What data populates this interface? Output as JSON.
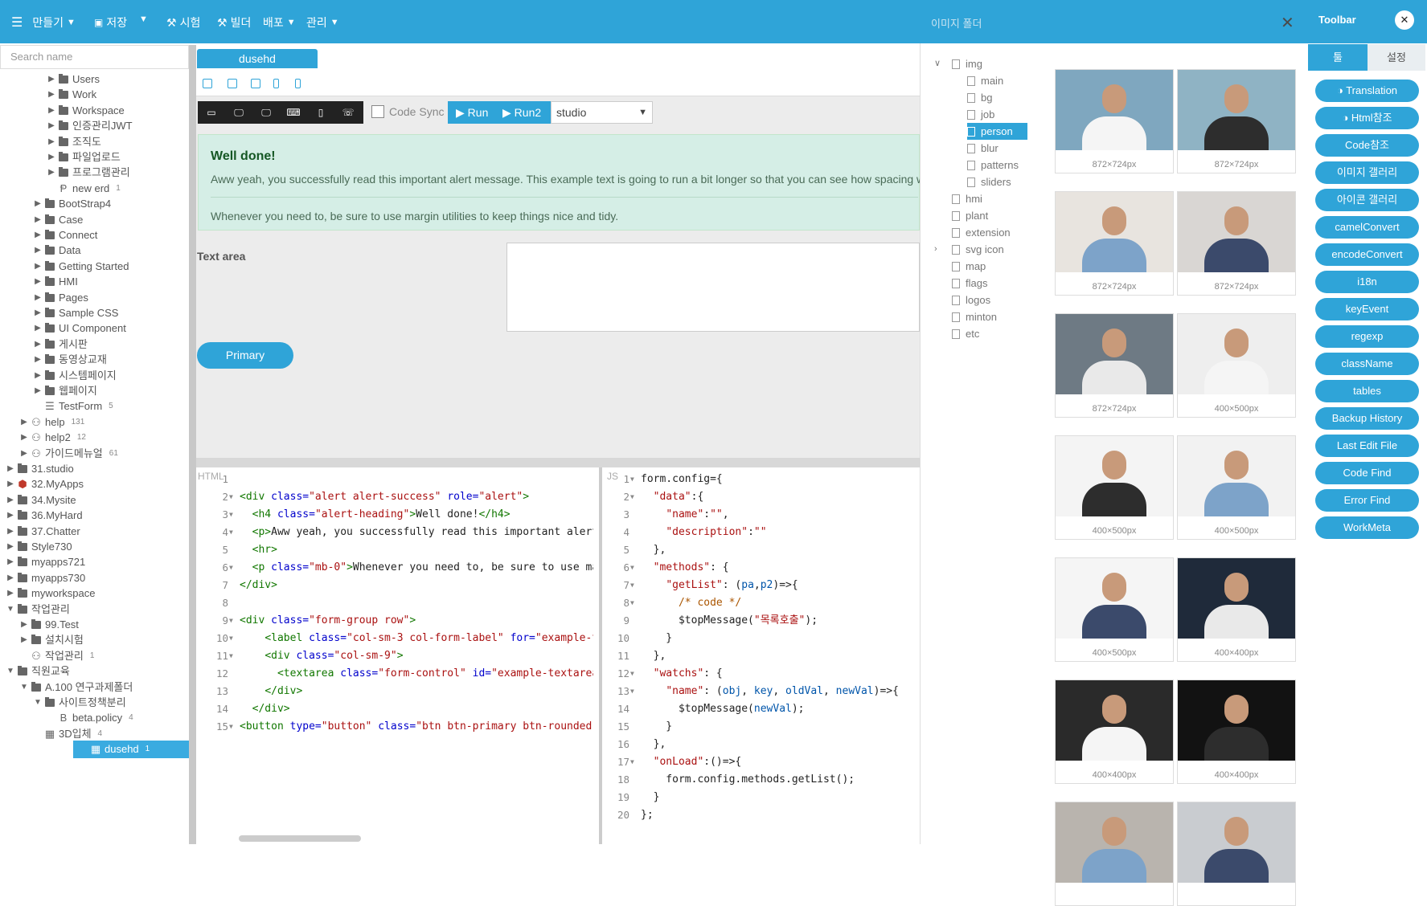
{
  "topbar": {
    "menu": [
      {
        "label": "만들기",
        "icon": "menu-icon",
        "chevron": true
      },
      {
        "label": "저장",
        "icon": "save-icon",
        "chevron": false
      },
      {
        "label": "",
        "icon": "",
        "chevron": true
      },
      {
        "label": "시험",
        "icon": "hammer-icon",
        "chevron": false
      },
      {
        "label": "빌더",
        "icon": "hammer-icon",
        "chevron": false
      },
      {
        "label": "배포",
        "icon": "",
        "chevron": true
      },
      {
        "label": "관리",
        "icon": "",
        "chevron": true
      }
    ]
  },
  "sidebar": {
    "search_placeholder": "Search name",
    "tree": [
      {
        "label": "Users",
        "indent": 3,
        "type": "folder",
        "arrow": "right"
      },
      {
        "label": "Work",
        "indent": 3,
        "type": "folder",
        "arrow": "right"
      },
      {
        "label": "Workspace",
        "indent": 3,
        "type": "folder",
        "arrow": "right"
      },
      {
        "label": "인증관리JWT",
        "indent": 3,
        "type": "folder",
        "arrow": "right"
      },
      {
        "label": "조직도",
        "indent": 3,
        "type": "folder",
        "arrow": "right"
      },
      {
        "label": "파일업로드",
        "indent": 3,
        "type": "folder",
        "arrow": "right"
      },
      {
        "label": "프로그램관리",
        "indent": 3,
        "type": "folder",
        "arrow": "right"
      },
      {
        "label": "new erd",
        "indent": 3,
        "type": "erd",
        "count": "1"
      },
      {
        "label": "BootStrap4",
        "indent": 2,
        "type": "folder",
        "arrow": "right"
      },
      {
        "label": "Case",
        "indent": 2,
        "type": "folder",
        "arrow": "right"
      },
      {
        "label": "Connect",
        "indent": 2,
        "type": "folder",
        "arrow": "right"
      },
      {
        "label": "Data",
        "indent": 2,
        "type": "folder",
        "arrow": "right"
      },
      {
        "label": "Getting Started",
        "indent": 2,
        "type": "folder",
        "arrow": "right"
      },
      {
        "label": "HMI",
        "indent": 2,
        "type": "folder",
        "arrow": "right"
      },
      {
        "label": "Pages",
        "indent": 2,
        "type": "folder",
        "arrow": "right"
      },
      {
        "label": "Sample CSS",
        "indent": 2,
        "type": "folder",
        "arrow": "right"
      },
      {
        "label": "UI Component",
        "indent": 2,
        "type": "folder",
        "arrow": "right"
      },
      {
        "label": "게시판",
        "indent": 2,
        "type": "folder",
        "arrow": "right"
      },
      {
        "label": "동영상교재",
        "indent": 2,
        "type": "folder",
        "arrow": "right"
      },
      {
        "label": "시스템페이지",
        "indent": 2,
        "type": "folder",
        "arrow": "right"
      },
      {
        "label": "웹페이지",
        "indent": 2,
        "type": "folder",
        "arrow": "right"
      },
      {
        "label": "TestForm",
        "indent": 2,
        "type": "form",
        "count": "5"
      },
      {
        "label": "help",
        "indent": 1,
        "type": "group",
        "arrow": "right",
        "count": "131"
      },
      {
        "label": "help2",
        "indent": 1,
        "type": "group",
        "arrow": "right",
        "count": "12"
      },
      {
        "label": "가이드메뉴얼",
        "indent": 1,
        "type": "group",
        "arrow": "right",
        "count": "61"
      },
      {
        "label": "31.studio",
        "indent": 0,
        "type": "folder",
        "arrow": "right"
      },
      {
        "label": "32.MyApps",
        "indent": 0,
        "type": "app",
        "arrow": "right"
      },
      {
        "label": "34.Mysite",
        "indent": 0,
        "type": "folder",
        "arrow": "right"
      },
      {
        "label": "36.MyHard",
        "indent": 0,
        "type": "folder",
        "arrow": "right"
      },
      {
        "label": "37.Chatter",
        "indent": 0,
        "type": "folder",
        "arrow": "right"
      },
      {
        "label": "Style730",
        "indent": 0,
        "type": "folder",
        "arrow": "right"
      },
      {
        "label": "myapps721",
        "indent": 0,
        "type": "folder",
        "arrow": "right"
      },
      {
        "label": "myapps730",
        "indent": 0,
        "type": "folder",
        "arrow": "right"
      },
      {
        "label": "myworkspace",
        "indent": 0,
        "type": "folder",
        "arrow": "right"
      },
      {
        "label": "작업관리",
        "indent": 0,
        "type": "folder",
        "arrow": "down"
      },
      {
        "label": "99.Test",
        "indent": 1,
        "type": "folder",
        "arrow": "right"
      },
      {
        "label": "설치시험",
        "indent": 1,
        "type": "folder",
        "arrow": "right"
      },
      {
        "label": "작업관리",
        "indent": 1,
        "type": "group",
        "count": "1"
      },
      {
        "label": "직원교육",
        "indent": 0,
        "type": "folder",
        "arrow": "down"
      },
      {
        "label": "A.100 연구과제폴더",
        "indent": 1,
        "type": "folder",
        "arrow": "down"
      },
      {
        "label": "사이트정책분리",
        "indent": 2,
        "type": "folder",
        "arrow": "down"
      },
      {
        "label": "beta.policy",
        "indent": 3,
        "type": "bold",
        "count": "4"
      },
      {
        "label": "3D입체",
        "indent": 2,
        "type": "grid",
        "count": "4"
      },
      {
        "label": "dusehd",
        "indent": 2,
        "type": "grid",
        "count": "1",
        "selected": true
      }
    ]
  },
  "editor": {
    "tab": "dusehd",
    "code_sync": "Code Sync",
    "run": "Run",
    "run2": "Run2",
    "studio": "studio",
    "devices": [
      "desktop-wide",
      "monitor",
      "monitor-large",
      "laptop",
      "tablet",
      "phone"
    ]
  },
  "preview": {
    "alert_heading": "Well done!",
    "alert_body": "Aww yeah, you successfully read this important alert message. This example text is going to run a bit longer so that you can see how spacing wit",
    "alert_foot": "Whenever you need to, be sure to use margin utilities to keep things nice and tidy.",
    "textarea_label": "Text area",
    "primary_button": "Primary"
  },
  "html_editor": {
    "label": "HTML",
    "lines": [
      "1",
      "2",
      "3",
      "4",
      "5",
      "6",
      "7",
      "8",
      "9",
      "10",
      "11",
      "12",
      "13",
      "14",
      "15"
    ]
  },
  "js_editor": {
    "label": "JS",
    "lines": [
      "1",
      "2",
      "3",
      "4",
      "5",
      "6",
      "7",
      "8",
      "9",
      "10",
      "11",
      "12",
      "13",
      "14",
      "15",
      "16",
      "17",
      "18",
      "19",
      "20"
    ]
  },
  "image_panel": {
    "title": "이미지 폴더",
    "folders": [
      {
        "label": "img",
        "level": 0,
        "arrow": "down"
      },
      {
        "label": "main",
        "level": 1
      },
      {
        "label": "bg",
        "level": 1
      },
      {
        "label": "job",
        "level": 1
      },
      {
        "label": "person",
        "level": 1,
        "selected": true
      },
      {
        "label": "blur",
        "level": 1
      },
      {
        "label": "patterns",
        "level": 1
      },
      {
        "label": "sliders",
        "level": 1
      },
      {
        "label": "hmi",
        "level": 0
      },
      {
        "label": "plant",
        "level": 0
      },
      {
        "label": "extension",
        "level": 0
      },
      {
        "label": "svg icon",
        "level": 0,
        "arrow": "right"
      },
      {
        "label": "map",
        "level": 0
      },
      {
        "label": "flags",
        "level": 0
      },
      {
        "label": "logos",
        "level": 0
      },
      {
        "label": "minton",
        "level": 0
      },
      {
        "label": "etc",
        "level": 0
      }
    ],
    "thumbs": [
      {
        "caption": "872×724px",
        "bg": "#7fa7bf"
      },
      {
        "caption": "872×724px",
        "bg": "#8fb3c4"
      },
      {
        "caption": "872×724px",
        "bg": "#e8e4df"
      },
      {
        "caption": "872×724px",
        "bg": "#d9d6d3"
      },
      {
        "caption": "872×724px",
        "bg": "#6e7a84"
      },
      {
        "caption": "400×500px",
        "bg": "#eeeeee"
      },
      {
        "caption": "400×500px",
        "bg": "#f4f4f4"
      },
      {
        "caption": "400×500px",
        "bg": "#f2f2f2"
      },
      {
        "caption": "400×500px",
        "bg": "#f5f5f5"
      },
      {
        "caption": "400×400px",
        "bg": "#1f2a3a"
      },
      {
        "caption": "400×400px",
        "bg": "#2a2a2a"
      },
      {
        "caption": "400×400px",
        "bg": "#121212"
      },
      {
        "caption": "",
        "bg": "#b9b4ae"
      },
      {
        "caption": "",
        "bg": "#c9ccd0"
      }
    ]
  },
  "toolbar": {
    "title": "Toolbar",
    "tab_tools": "툴",
    "tab_settings": "설정",
    "buttons": [
      "Translation",
      "Html참조",
      "Code참조",
      "이미지 갤러리",
      "아이콘 갤러리",
      "camelConvert",
      "encodeConvert",
      "i18n",
      "keyEvent",
      "regexp",
      "className",
      "tables",
      "Backup History",
      "Last Edit File",
      "Code Find",
      "Error Find",
      "WorkMeta"
    ]
  }
}
